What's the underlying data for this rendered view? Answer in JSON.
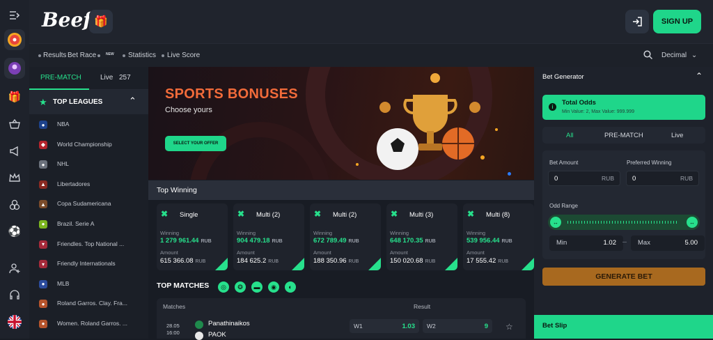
{
  "brand": {
    "logo": "Beef",
    "accent": "#27e08c",
    "bonus_color": "#f26b3a"
  },
  "header": {
    "signup_label": "SIGN UP"
  },
  "subnav": {
    "items": [
      "Results",
      "Bet Race",
      "Statistics",
      "Live Score"
    ],
    "new_badge": "NEW",
    "odds_format": "Decimal"
  },
  "rail_icons": [
    "menu-collapse-icon",
    "wheel-icon",
    "avatar-icon",
    "gift-icon",
    "basket-icon",
    "megaphone-icon",
    "crown-icon",
    "rings-icon",
    "football-icon",
    "add-user-icon",
    "headset-icon",
    "uk-flag-icon"
  ],
  "sidebar": {
    "tab_prematch": "PRE-MATCH",
    "tab_live": "Live",
    "live_count": "257",
    "top_leagues": "TOP LEAGUES",
    "leagues": [
      "NBA",
      "World Championship",
      "NHL",
      "Libertadores",
      "Copa Sudamericana",
      "Brazil. Serie A",
      "Friendles. Top National ...",
      "Friendly Internationals",
      "MLB",
      "Roland Garros. Clay. Fra...",
      "Women. Roland Garros. ..."
    ]
  },
  "banner": {
    "title": "SPORTS BONUSES",
    "subtitle": "Choose yours",
    "button": "SELECT YOUR OFFER"
  },
  "top_winning": {
    "title": "Top Winning",
    "winning_label": "Winning",
    "amount_label": "Amount",
    "currency": "RUB",
    "cards": [
      {
        "type": "Single",
        "count": "",
        "winning": "1 279 961.44",
        "amount": "615 366.08"
      },
      {
        "type": "Multi",
        "count": "(2)",
        "winning": "904 479.18",
        "amount": "184 625.2"
      },
      {
        "type": "Multi",
        "count": "(2)",
        "winning": "672 789.49",
        "amount": "188 350.96"
      },
      {
        "type": "Multi",
        "count": "(3)",
        "winning": "648 170.35",
        "amount": "150 020.68"
      },
      {
        "type": "Multi",
        "count": "(8)",
        "winning": "539 956.44",
        "amount": "17 555.42"
      }
    ]
  },
  "top_matches": {
    "title": "TOP MATCHES",
    "col_matches": "Matches",
    "col_result": "Result",
    "match": {
      "date": "28.05",
      "time": "16:00",
      "team1": "Panathinaikos",
      "team2": "PAOK",
      "w1_label": "W1",
      "w1": "1.03",
      "w2_label": "W2",
      "w2": "9"
    }
  },
  "bet_generator": {
    "title": "Bet Generator",
    "total_odds": "Total Odds",
    "total_sub": "Min Value: 2, Max Value: 999.999",
    "tabs": [
      "All",
      "PRE-MATCH",
      "Live"
    ],
    "bet_amount_label": "Bet Amount",
    "bet_amount": "0",
    "preferred_label": "Preferred Winning",
    "preferred": "0",
    "unit": "RUB",
    "odd_range_label": "Odd Range",
    "min_label": "Min",
    "min": "1.02",
    "max_label": "Max",
    "max": "5.00",
    "generate": "GENERATE BET"
  },
  "bet_slip": {
    "title": "Bet Slip"
  }
}
